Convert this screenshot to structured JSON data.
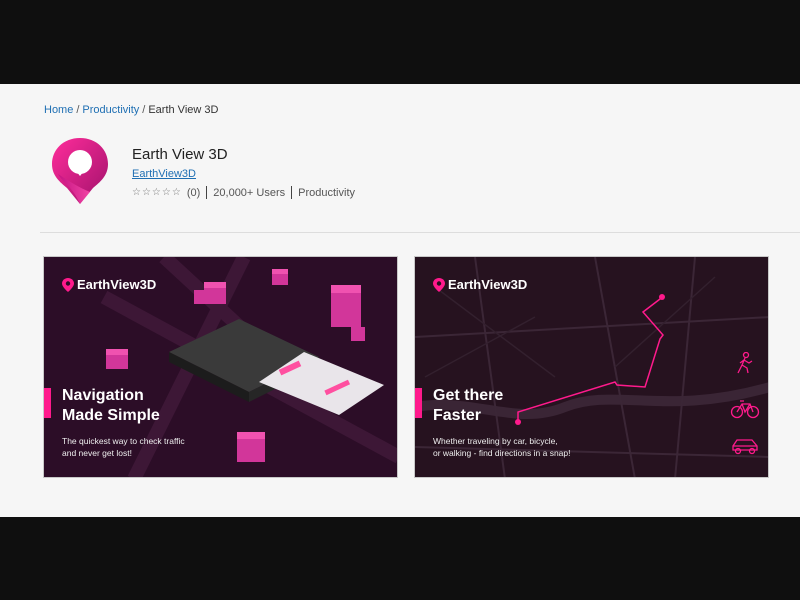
{
  "breadcrumb": {
    "home": "Home",
    "category": "Productivity",
    "current": "Earth View 3D",
    "separator": "/"
  },
  "app": {
    "title": "Earth View 3D",
    "publisher": "EarthView3D",
    "stars": "☆☆☆☆☆",
    "rating_count": "(0)",
    "users": "20,000+ Users",
    "category": "Productivity",
    "accent_color": "#ff1a8c"
  },
  "screenshots": [
    {
      "brand": "EarthView3D",
      "headline_line1": "Navigation",
      "headline_line2": "Made Simple",
      "sub_line1": "The quickest way to check traffic",
      "sub_line2": "and never get lost!"
    },
    {
      "brand": "EarthView3D",
      "headline_line1": "Get there",
      "headline_line2": "Faster",
      "sub_line1": "Whether traveling by car, bicycle,",
      "sub_line2": "or walking - find directions in a snap!",
      "modes": [
        "walking-icon",
        "bicycle-icon",
        "car-icon"
      ]
    }
  ]
}
